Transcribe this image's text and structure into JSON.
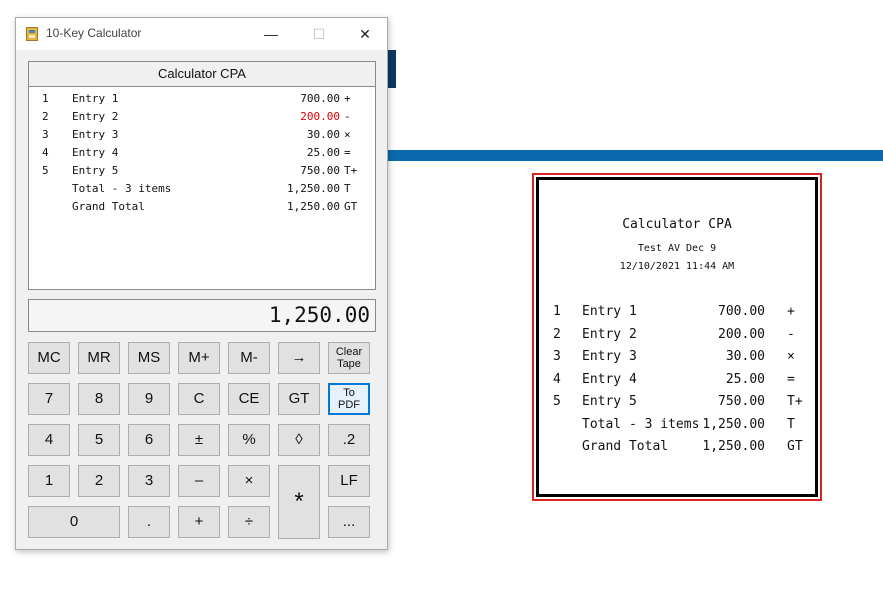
{
  "window": {
    "title": "10-Key Calculator",
    "minimize": "—",
    "maximize": "☐",
    "close": "✕"
  },
  "tape": {
    "header": "Calculator CPA",
    "rows": [
      {
        "num": "1",
        "label": "Entry 1",
        "amount": "700.00",
        "op": "+"
      },
      {
        "num": "2",
        "label": "Entry 2",
        "amount": "200.00",
        "op": "-"
      },
      {
        "num": "3",
        "label": "Entry 3",
        "amount": "30.00",
        "op": "×"
      },
      {
        "num": "4",
        "label": "Entry 4",
        "amount": "25.00",
        "op": "="
      },
      {
        "num": "5",
        "label": "Entry 5",
        "amount": "750.00",
        "op": "T+"
      },
      {
        "num": "",
        "label": "Total - 3 items",
        "amount": "1,250.00",
        "op": "T"
      },
      {
        "num": "",
        "label": "Grand Total",
        "amount": "1,250.00",
        "op": "GT"
      }
    ]
  },
  "display": {
    "value": "1,250.00"
  },
  "keys": {
    "mc": "MC",
    "mr": "MR",
    "ms": "MS",
    "mplus": "M+",
    "mminus": "M-",
    "arrow": "→",
    "clear_tape_1": "Clear",
    "clear_tape_2": "Tape",
    "k7": "7",
    "k8": "8",
    "k9": "9",
    "c": "C",
    "ce": "CE",
    "gt": "GT",
    "to_pdf_1": "To",
    "to_pdf_2": "PDF",
    "k4": "4",
    "k5": "5",
    "k6": "6",
    "plusminus": "±",
    "percent": "%",
    "diamond": "◊",
    "dec2": ".2",
    "k1": "1",
    "k2": "2",
    "k3": "3",
    "minus": "–",
    "times": "×",
    "multiply_big": "*",
    "lf": "LF",
    "k0": "0",
    "dot": ".",
    "plus": "+",
    "divide": "÷",
    "ellipsis": "..."
  },
  "receipt": {
    "title": "Calculator CPA",
    "subtitle": "Test AV Dec 9",
    "datetime": "12/10/2021 11:44 AM",
    "rows": [
      {
        "num": "1",
        "label": "Entry 1",
        "amount": "700.00",
        "op": "+"
      },
      {
        "num": "2",
        "label": "Entry 2",
        "amount": "200.00",
        "op": "-"
      },
      {
        "num": "3",
        "label": "Entry 3",
        "amount": "30.00",
        "op": "×"
      },
      {
        "num": "4",
        "label": "Entry 4",
        "amount": "25.00",
        "op": "="
      },
      {
        "num": "5",
        "label": "Entry 5",
        "amount": "750.00",
        "op": "T+"
      },
      {
        "num": "",
        "label": "Total - 3 items",
        "amount": "1,250.00",
        "op": "T"
      },
      {
        "num": "",
        "label": "Grand Total",
        "amount": "1,250.00",
        "op": "GT"
      }
    ]
  },
  "colors": {
    "negative_entry": "#e00000",
    "accent_blue": "#0a6aad",
    "navy": "#0b3a63",
    "receipt_border": "#d22"
  }
}
